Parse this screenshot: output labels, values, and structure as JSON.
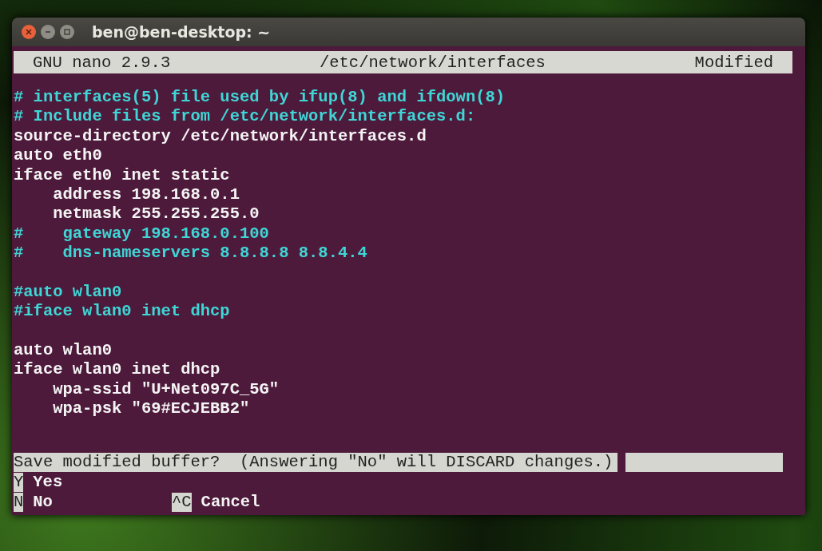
{
  "window": {
    "title": "ben@ben-desktop: ~"
  },
  "nano_header": {
    "version": "GNU nano 2.9.3",
    "filename": "/etc/network/interfaces",
    "status": "Modified"
  },
  "lines": [
    {
      "kind": "comment",
      "text": "# interfaces(5) file used by ifup(8) and ifdown(8)"
    },
    {
      "kind": "comment",
      "text": "# Include files from /etc/network/interfaces.d:"
    },
    {
      "kind": "code",
      "text": "source-directory /etc/network/interfaces.d"
    },
    {
      "kind": "code",
      "text": "auto eth0"
    },
    {
      "kind": "code",
      "text": "iface eth0 inet static"
    },
    {
      "kind": "code",
      "text": "    address 198.168.0.1"
    },
    {
      "kind": "code",
      "text": "    netmask 255.255.255.0"
    },
    {
      "kind": "comment",
      "text": "#    gateway 198.168.0.100"
    },
    {
      "kind": "comment",
      "text": "#    dns-nameservers 8.8.8.8 8.8.4.4"
    },
    {
      "kind": "blank"
    },
    {
      "kind": "comment",
      "text": "#auto wlan0"
    },
    {
      "kind": "comment",
      "text": "#iface wlan0 inet dhcp"
    },
    {
      "kind": "blank"
    },
    {
      "kind": "code",
      "text": "auto wlan0"
    },
    {
      "kind": "code",
      "text": "iface wlan0 inet dhcp"
    },
    {
      "kind": "code",
      "text": "    wpa-ssid \"U+Net097C_5G\""
    },
    {
      "kind": "code",
      "text": "    wpa-psk \"69#ECJEBB2\""
    }
  ],
  "prompt": {
    "text": "Save modified buffer?  (Answering \"No\" will DISCARD changes.)"
  },
  "shortcut_rows": [
    [
      {
        "key": "Y",
        "label": "Yes"
      }
    ],
    [
      {
        "key": "N",
        "label": "No"
      },
      {
        "key": "^C",
        "label": "Cancel"
      }
    ]
  ]
}
